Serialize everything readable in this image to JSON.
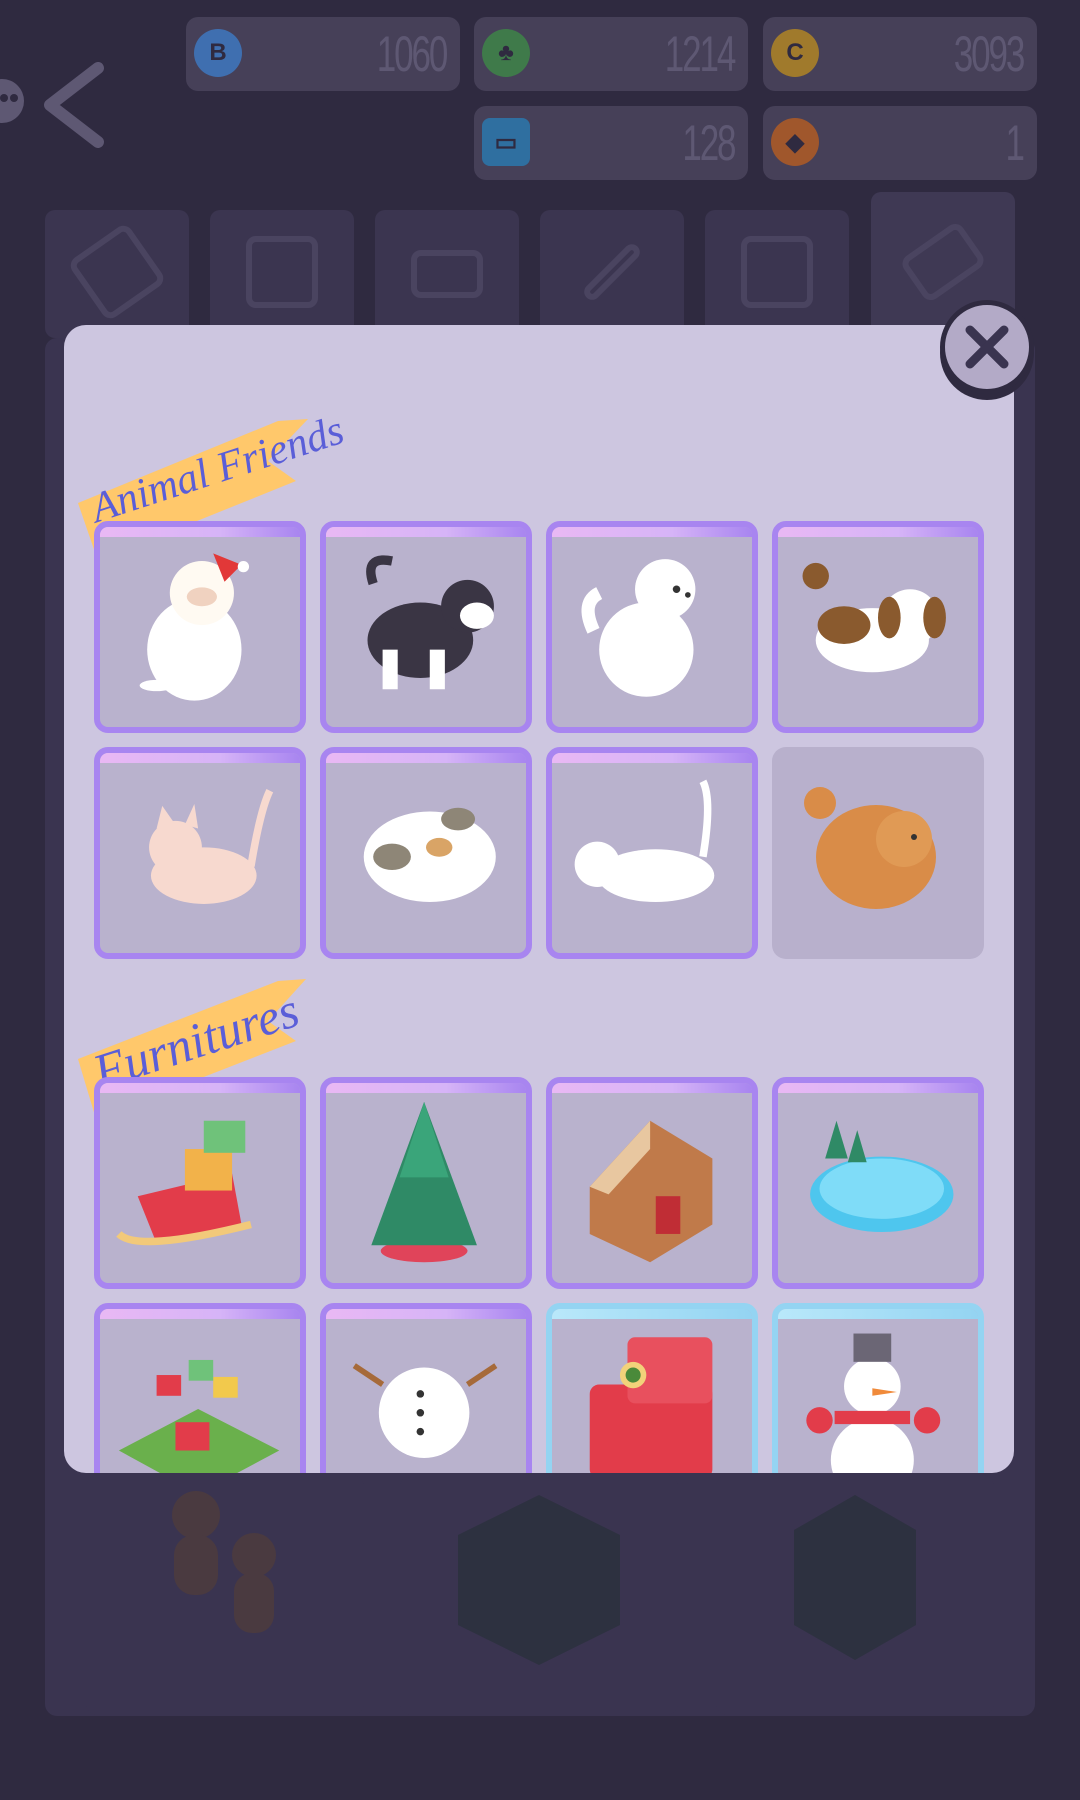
{
  "currencies": [
    {
      "name": "coin-blue",
      "value": "1060",
      "color": "#3f6fb0"
    },
    {
      "name": "clover",
      "value": "1214",
      "color": "#3f7a4a"
    },
    {
      "name": "coin-gold",
      "value": "3093",
      "color": "#a07a2c"
    },
    {
      "name": "ticket",
      "value": "128",
      "color": "#2f6fa0"
    },
    {
      "name": "gem",
      "value": "1",
      "color": "#a0572c"
    }
  ],
  "sections": {
    "animals_title": "Animal Friends",
    "furnitures_title": "Furnitures"
  },
  "animals": [
    {
      "name": "ragdoll cat with santa hat"
    },
    {
      "name": "husky"
    },
    {
      "name": "samoyed"
    },
    {
      "name": "shih tzu"
    },
    {
      "name": "pink sphynx cat"
    },
    {
      "name": "calico cat"
    },
    {
      "name": "white cat"
    },
    {
      "name": "pomeranian"
    }
  ],
  "furnitures": [
    {
      "name": "santa sleigh"
    },
    {
      "name": "christmas tree"
    },
    {
      "name": "gingerbread house"
    },
    {
      "name": "ice skating rink"
    },
    {
      "name": "gift garden"
    },
    {
      "name": "snowman body"
    },
    {
      "name": "christmas armchair"
    },
    {
      "name": "snowman"
    }
  ],
  "colors": {
    "panel": "#cdc6e0",
    "card_border": "#a885f0",
    "card_border_rare": "#94d4f2",
    "ribbon": "#ffc86b",
    "ribbon_text": "#5a5ed8"
  }
}
